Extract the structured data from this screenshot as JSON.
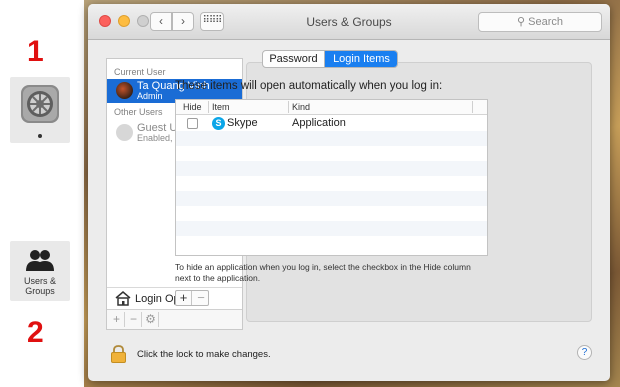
{
  "annotations": {
    "step1": "1",
    "step2": "2"
  },
  "dock": {
    "system_prefs_icon": "system-preferences-icon",
    "users_groups": {
      "icon": "users-icon",
      "label": "Users & Groups"
    }
  },
  "window": {
    "title": "Users & Groups",
    "search": {
      "placeholder": "Search"
    },
    "nav": {
      "back": "‹",
      "forward": "›",
      "grid": "⠿⠿⠿"
    }
  },
  "sidebar": {
    "current_user_heading": "Current User",
    "current_user": {
      "name": "Ta Quang Vinh",
      "role": "Admin"
    },
    "other_users_heading": "Other Users",
    "other_users": [
      {
        "name": "Guest User",
        "role": "Enabled, Managed"
      }
    ],
    "login_options_label": "Login Options",
    "tools": {
      "add": "+",
      "remove": "−",
      "settings": "⚙"
    }
  },
  "tabs": [
    {
      "label": "Password",
      "selected": false
    },
    {
      "label": "Login Items",
      "selected": true
    }
  ],
  "login_items": {
    "intro": "These items will open automatically when you log in:",
    "columns": {
      "hide": "Hide",
      "item": "Item",
      "kind": "Kind"
    },
    "rows": [
      {
        "hide": false,
        "item": "Skype",
        "kind": "Application",
        "icon": "skype-icon"
      }
    ],
    "hint": "To hide an application when you log in, select the checkbox in the Hide column next to the application.",
    "add": "+",
    "remove": "−"
  },
  "footer": {
    "lock_message": "Click the lock to make changes.",
    "help": "?"
  },
  "colors": {
    "selection": "#1a6cd5",
    "tab_selected": "#1a7ff0",
    "annotation": "#e01010"
  }
}
